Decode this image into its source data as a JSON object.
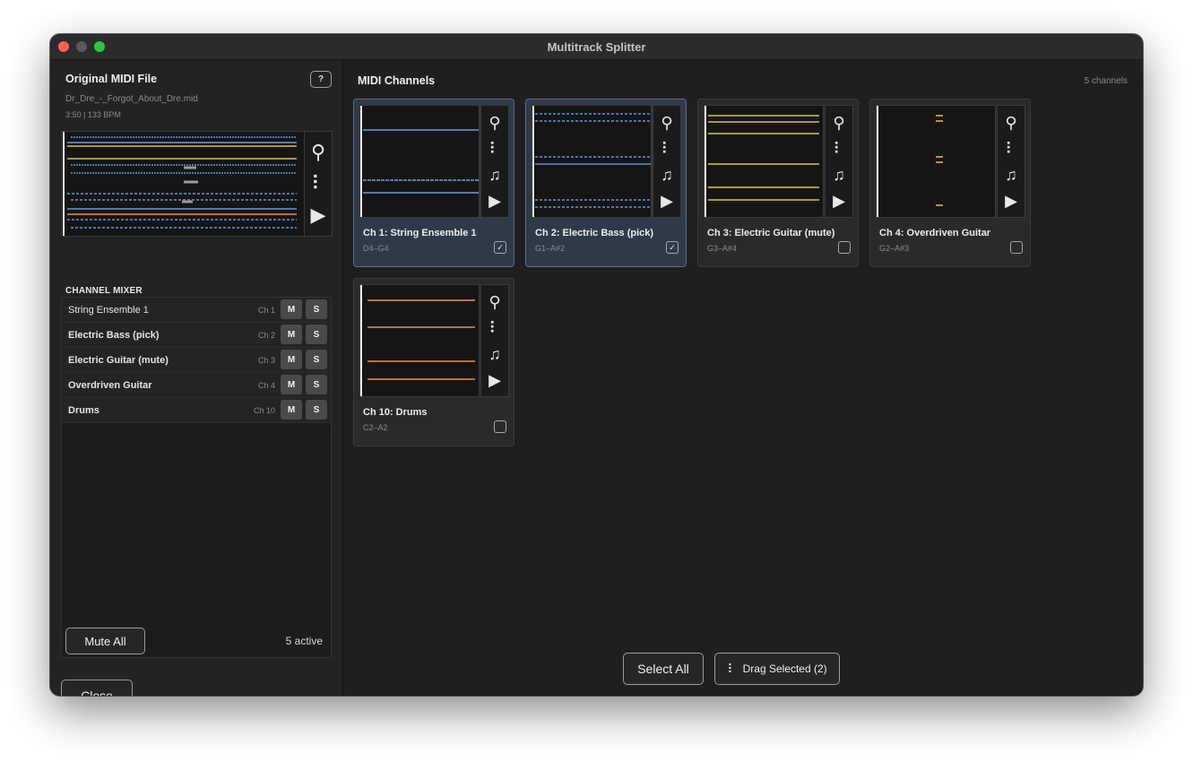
{
  "window": {
    "title": "Multitrack Splitter"
  },
  "left": {
    "title": "Original MIDI File",
    "help_label": "?",
    "filename": "Dr_Dre_-_Forgot_About_Dre.mid",
    "info": "3:50 | 133 BPM"
  },
  "mixer": {
    "title": "CHANNEL MIXER",
    "rows": [
      {
        "name": "String Ensemble 1",
        "ch": "Ch 1",
        "mute": "M",
        "solo": "S"
      },
      {
        "name": "Electric Bass (pick)",
        "ch": "Ch 2",
        "mute": "M",
        "solo": "S"
      },
      {
        "name": "Electric Guitar (mute)",
        "ch": "Ch 3",
        "mute": "M",
        "solo": "S"
      },
      {
        "name": "Overdriven Guitar",
        "ch": "Ch 4",
        "mute": "M",
        "solo": "S"
      },
      {
        "name": "Drums",
        "ch": "Ch 10",
        "mute": "M",
        "solo": "S"
      }
    ],
    "mute_all_label": "Mute All",
    "active_count": "5 active"
  },
  "close_label": "Close",
  "channels": {
    "title": "MIDI Channels",
    "count": "5 channels",
    "cards": [
      {
        "name": "Ch 1: String Ensemble 1",
        "range": "D4–G4",
        "selected": true,
        "check": "✓",
        "color": "#5b7aa8"
      },
      {
        "name": "Ch 2: Electric Bass (pick)",
        "range": "G1–A#2",
        "selected": true,
        "check": "✓",
        "color": "#4f74a8"
      },
      {
        "name": "Ch 3: Electric Guitar (mute)",
        "range": "G3–A#4",
        "selected": false,
        "check": "",
        "color": "#a89a3c"
      },
      {
        "name": "Ch 4: Overdriven Guitar",
        "range": "G2–A#3",
        "selected": false,
        "check": "",
        "color": "#c8902e"
      },
      {
        "name": "Ch 10: Drums",
        "range": "C2–A2",
        "selected": false,
        "check": "",
        "color": "#b5733e"
      }
    ]
  },
  "icons": {
    "zoom": "⚲",
    "drag": "⠇",
    "notes": "♫",
    "play": "▶"
  },
  "bottom": {
    "select_all_label": "Select All",
    "drag_selected_label": "Drag Selected (2)"
  }
}
